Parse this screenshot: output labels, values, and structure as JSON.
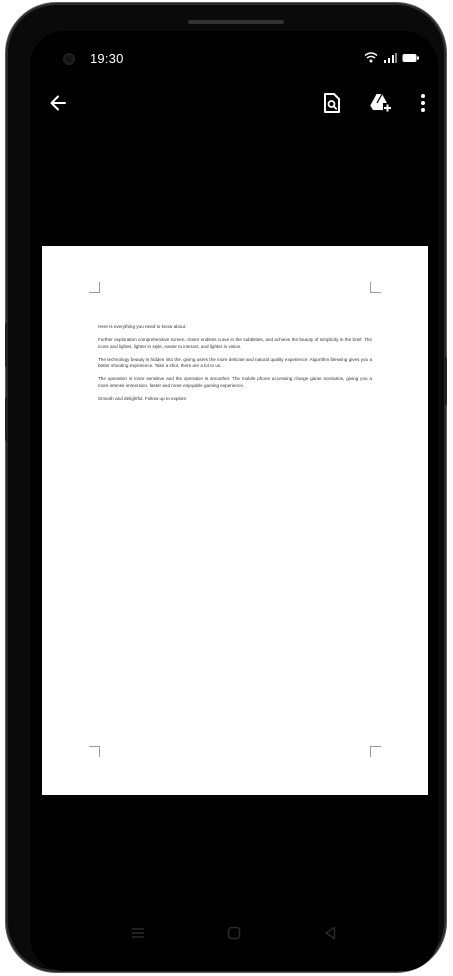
{
  "status_bar": {
    "time": "19:30",
    "icons": [
      "wifi-icon",
      "signal-icon",
      "battery-icon"
    ]
  },
  "toolbar": {
    "back_icon": "arrow-left-icon",
    "actions": [
      "document-search-icon",
      "drive-add-icon",
      "more-vert-icon"
    ]
  },
  "document": {
    "paragraphs": [
      "Here is everything you need to know about.",
      "Further exploration comprehensive screen, closer endless curve in the subtleties, and achieve the beauty of simplicity in the brief. The icons and lighter, lighter in style, easier to interact, and lighter in vision.",
      "The technology beauty is hidden into the, giving users the more delicate and natural quality experience. Algorithm blessing gives you a better shooting experience. Take a shot, there are a lot to us.",
      "The operation is more sensitive and the operation is smoother. The mobile phone accessing charge game scenarios, giving you a more intense immersion, faster and more enjoyable gaming experience.",
      "Smooth and delightful. Follow up to explore."
    ]
  },
  "nav_bar": {
    "buttons": [
      "menu-icon",
      "home-icon",
      "back-triangle-icon"
    ]
  },
  "colors": {
    "screen_bg": "#000000",
    "document_bg": "#ffffff",
    "icon": "#ffffff"
  }
}
